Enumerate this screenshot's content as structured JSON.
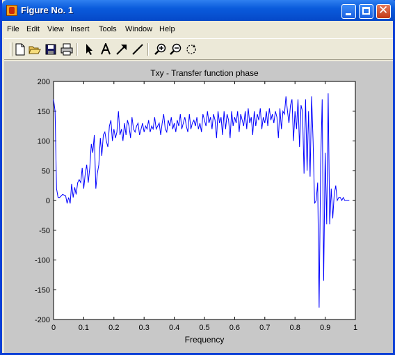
{
  "window": {
    "title": "Figure No. 1"
  },
  "menu": [
    "File",
    "Edit",
    "View",
    "Insert",
    "Tools",
    "Window",
    "Help"
  ],
  "toolbar_icons": [
    "new-file-icon",
    "open-folder-icon",
    "save-icon",
    "print-icon",
    "arrow-pointer-icon",
    "text-insert-icon",
    "arrow-draw-icon",
    "line-draw-icon",
    "zoom-in-icon",
    "zoom-out-icon",
    "rotate-icon"
  ],
  "chart_data": {
    "type": "line",
    "title": "Txy - Transfer function phase",
    "xlabel": "Frequency",
    "ylabel": "",
    "xlim": [
      0,
      1
    ],
    "ylim": [
      -200,
      200
    ],
    "xticks": [
      "0",
      "0.1",
      "0.2",
      "0.3",
      "0.4",
      "0.5",
      "0.6",
      "0.7",
      "0.8",
      "0.9",
      "1"
    ],
    "yticks": [
      "-200",
      "-150",
      "-100",
      "-50",
      "0",
      "50",
      "100",
      "150",
      "200"
    ],
    "grid": false,
    "line_color": "#0000ff",
    "x": [
      0.0,
      0.005,
      0.01,
      0.015,
      0.02,
      0.03,
      0.04,
      0.045,
      0.05,
      0.055,
      0.06,
      0.065,
      0.07,
      0.075,
      0.08,
      0.085,
      0.09,
      0.095,
      0.1,
      0.105,
      0.11,
      0.115,
      0.12,
      0.125,
      0.13,
      0.135,
      0.14,
      0.145,
      0.15,
      0.155,
      0.16,
      0.165,
      0.17,
      0.175,
      0.18,
      0.185,
      0.19,
      0.195,
      0.2,
      0.205,
      0.21,
      0.215,
      0.22,
      0.225,
      0.23,
      0.235,
      0.24,
      0.245,
      0.25,
      0.255,
      0.26,
      0.265,
      0.27,
      0.275,
      0.28,
      0.285,
      0.29,
      0.295,
      0.3,
      0.305,
      0.31,
      0.315,
      0.32,
      0.325,
      0.33,
      0.335,
      0.34,
      0.345,
      0.35,
      0.355,
      0.36,
      0.365,
      0.37,
      0.375,
      0.38,
      0.385,
      0.39,
      0.395,
      0.4,
      0.405,
      0.41,
      0.415,
      0.42,
      0.425,
      0.43,
      0.435,
      0.44,
      0.445,
      0.45,
      0.455,
      0.46,
      0.465,
      0.47,
      0.475,
      0.48,
      0.485,
      0.49,
      0.495,
      0.5,
      0.505,
      0.51,
      0.515,
      0.52,
      0.525,
      0.53,
      0.535,
      0.54,
      0.545,
      0.55,
      0.555,
      0.56,
      0.565,
      0.57,
      0.575,
      0.58,
      0.585,
      0.59,
      0.595,
      0.6,
      0.605,
      0.61,
      0.615,
      0.62,
      0.625,
      0.63,
      0.635,
      0.64,
      0.645,
      0.65,
      0.655,
      0.66,
      0.665,
      0.67,
      0.675,
      0.68,
      0.685,
      0.69,
      0.695,
      0.7,
      0.705,
      0.71,
      0.715,
      0.72,
      0.725,
      0.73,
      0.735,
      0.74,
      0.745,
      0.75,
      0.755,
      0.76,
      0.765,
      0.77,
      0.775,
      0.78,
      0.785,
      0.79,
      0.795,
      0.8,
      0.805,
      0.81,
      0.815,
      0.82,
      0.825,
      0.83,
      0.835,
      0.84,
      0.845,
      0.85,
      0.855,
      0.86,
      0.865,
      0.87,
      0.875,
      0.88,
      0.885,
      0.89,
      0.895,
      0.9,
      0.905,
      0.91,
      0.915,
      0.92,
      0.925,
      0.93,
      0.935,
      0.94,
      0.945,
      0.95,
      0.955,
      0.96,
      0.965,
      0.97,
      0.975,
      0.98,
      0.985,
      0.99,
      0.995,
      1.0
    ],
    "y": [
      170,
      150,
      20,
      5,
      5,
      10,
      8,
      -5,
      5,
      -5,
      28,
      5,
      22,
      10,
      30,
      35,
      30,
      55,
      20,
      45,
      60,
      30,
      55,
      95,
      80,
      110,
      20,
      45,
      60,
      105,
      75,
      110,
      115,
      100,
      90,
      125,
      135,
      100,
      120,
      105,
      115,
      150,
      110,
      120,
      100,
      130,
      110,
      135,
      125,
      105,
      140,
      120,
      115,
      125,
      130,
      110,
      120,
      130,
      115,
      125,
      120,
      135,
      115,
      125,
      120,
      140,
      120,
      125,
      130,
      110,
      130,
      145,
      120,
      115,
      135,
      125,
      140,
      120,
      130,
      115,
      135,
      125,
      145,
      120,
      130,
      140,
      125,
      115,
      145,
      120,
      130,
      135,
      125,
      140,
      120,
      130,
      115,
      145,
      135,
      125,
      150,
      130,
      140,
      120,
      145,
      135,
      105,
      150,
      130,
      140,
      110,
      150,
      120,
      145,
      135,
      105,
      150,
      125,
      140,
      130,
      150,
      115,
      145,
      135,
      125,
      150,
      120,
      155,
      130,
      140,
      110,
      150,
      125,
      145,
      135,
      155,
      120,
      140,
      130,
      150,
      125,
      155,
      135,
      145,
      130,
      150,
      140,
      105,
      155,
      120,
      150,
      145,
      175,
      150,
      130,
      160,
      170,
      100,
      150,
      120,
      170,
      90,
      160,
      150,
      45,
      170,
      50,
      150,
      40,
      175,
      100,
      -5,
      0,
      30,
      -180,
      60,
      170,
      -135,
      80,
      -40,
      180,
      -40,
      20,
      -30,
      10,
      25,
      0,
      5,
      5,
      0,
      5,
      0,
      0,
      0,
      0
    ]
  }
}
